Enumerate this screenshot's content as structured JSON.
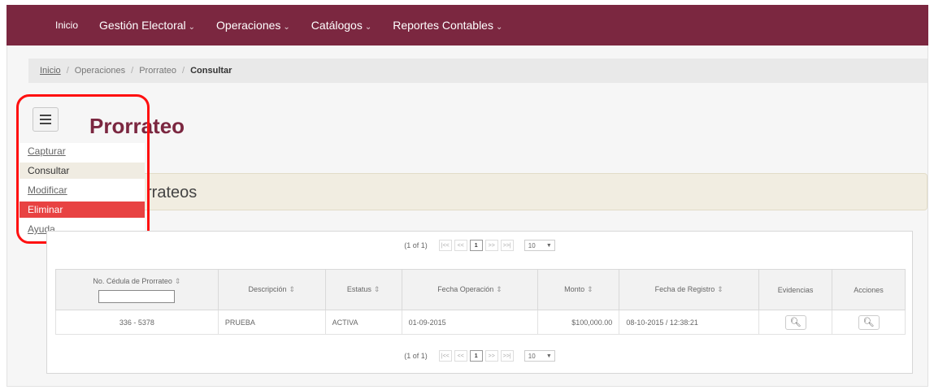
{
  "nav": {
    "items": [
      {
        "label": "Inicio",
        "caret": ""
      },
      {
        "label": "Gestión Electoral",
        "caret": "⌄"
      },
      {
        "label": "Operaciones",
        "caret": "⌄"
      },
      {
        "label": "Catálogos",
        "caret": "⌄"
      },
      {
        "label": "Reportes Contables",
        "caret": "⌄"
      }
    ],
    "color": "#7b2740"
  },
  "breadcrumb": {
    "items": [
      "Inicio",
      "Operaciones",
      "Prorrateo",
      "Consultar"
    ],
    "separator": "/"
  },
  "page": {
    "title": "Prorrateo",
    "section_title": "rrateos"
  },
  "dropdown": {
    "options": [
      "Capturar",
      "Consultar",
      "Modificar",
      "Eliminar",
      "Ayuda"
    ]
  },
  "pager": {
    "count": "(1 of 1)",
    "first": "|<<",
    "prev": "<<",
    "page": "1",
    "next": ">>",
    "last": ">>|",
    "rows": "10",
    "rows_arrow": "▼"
  },
  "table": {
    "headers": [
      "No. Cédula de Prorrateo",
      "Descripción",
      "Estatus",
      "Fecha Operación",
      "Monto",
      "Fecha de Registro",
      "Evidencias",
      "Acciones"
    ],
    "sort_icon": "⇕",
    "rows": [
      {
        "cedula": "336 - 5378",
        "descripcion": "PRUEBA",
        "estatus": "ACTIVA",
        "fecha_operacion": "01-09-2015",
        "monto": "$100,000.00",
        "fecha_registro": "08-10-2015 / 12:38:21"
      }
    ],
    "search_icon_glyph": "🔍︎"
  }
}
